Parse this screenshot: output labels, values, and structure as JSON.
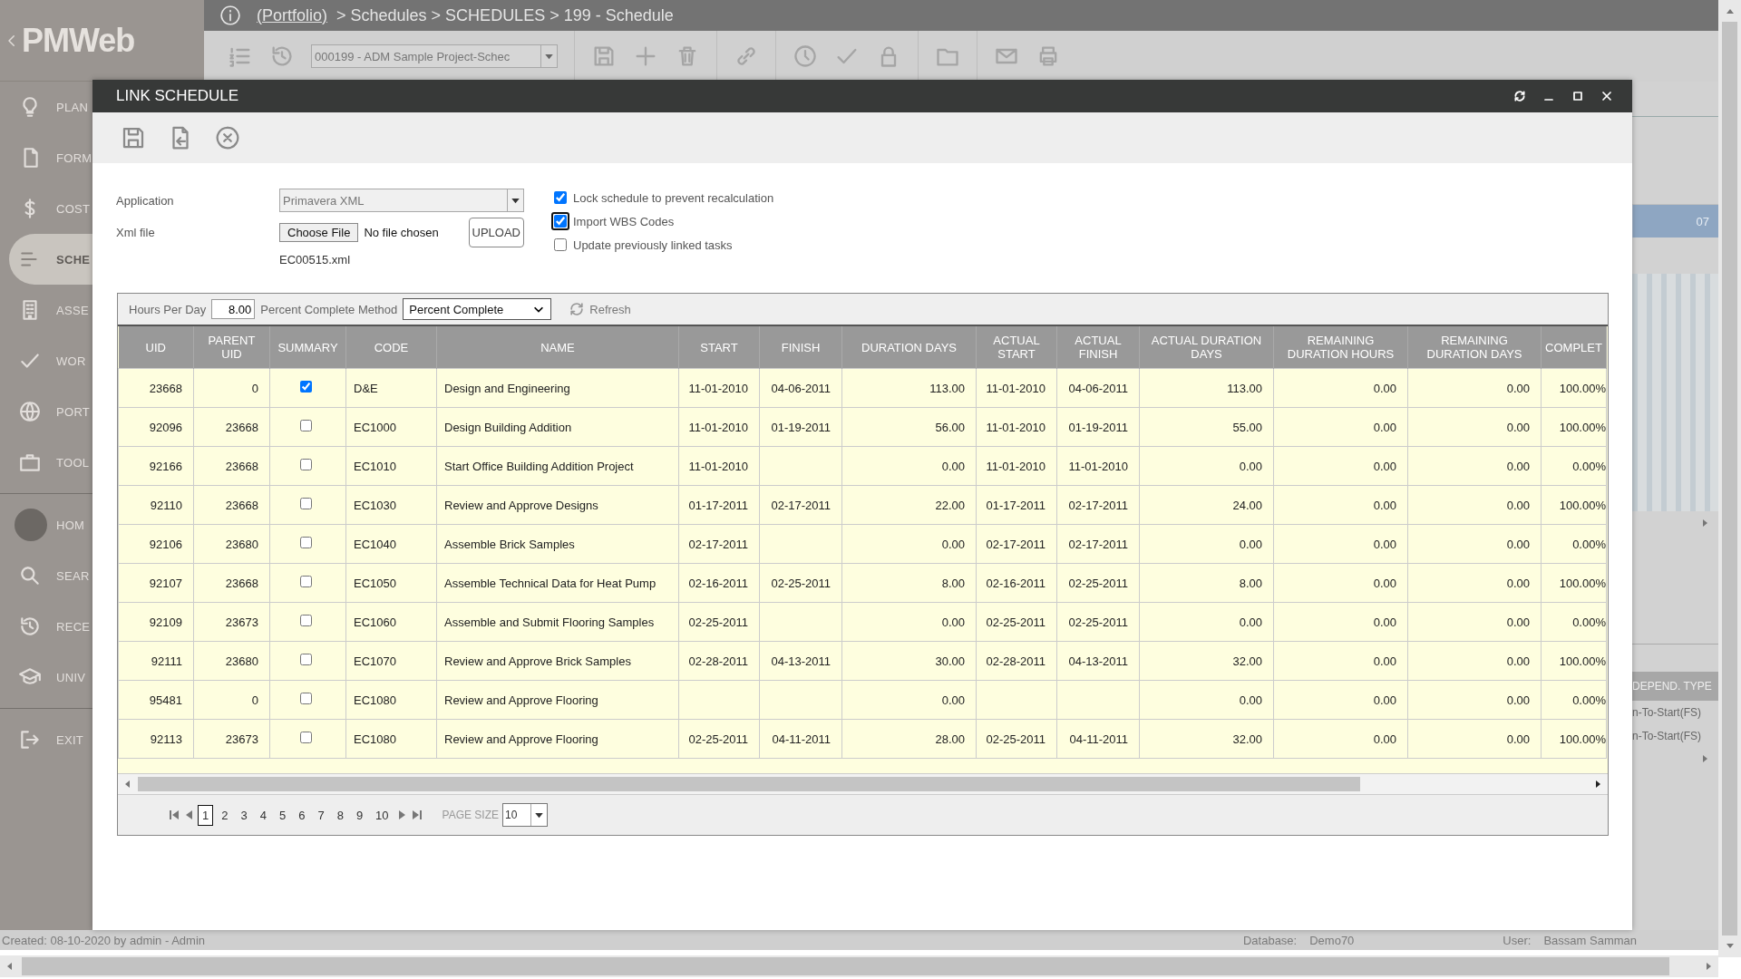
{
  "header": {
    "logo": "PMWeb",
    "breadcrumb_link": "(Portfolio)",
    "breadcrumb": "> Schedules > SCHEDULES > 199 - Schedule"
  },
  "toolbar": {
    "record": "000199 - ADM Sample Project-Schec"
  },
  "sidebar": {
    "groups": [
      {
        "items": [
          {
            "label": "PLAN",
            "selected": false
          },
          {
            "label": "FORM",
            "selected": false
          },
          {
            "label": "COST",
            "selected": false
          },
          {
            "label": "SCHE",
            "selected": true
          },
          {
            "label": "ASSE",
            "selected": false
          },
          {
            "label": "WOR",
            "selected": false
          },
          {
            "label": "PORT",
            "selected": false
          },
          {
            "label": "TOOL",
            "selected": false
          }
        ]
      },
      {
        "items": [
          {
            "label": "HOM",
            "selected": false
          },
          {
            "label": "SEAR",
            "selected": false
          },
          {
            "label": "RECE",
            "selected": false
          },
          {
            "label": "UNIV",
            "selected": false
          }
        ]
      },
      {
        "items": [
          {
            "label": "EXIT",
            "selected": false
          }
        ]
      }
    ]
  },
  "background": {
    "gantt_label": "07",
    "column_header": "DEPEND. TYPE",
    "cells": [
      "n-To-Start(FS)",
      "n-To-Start(FS)"
    ]
  },
  "dialog": {
    "title": "LINK SCHEDULE",
    "form": {
      "application_label": "Application",
      "application": "Primavera XML",
      "xml_label": "Xml file",
      "choose_button": "Choose File",
      "file_status": "No file chosen",
      "upload_button": "UPLOAD",
      "file_name": "EC00515.xml",
      "options": [
        {
          "label": "Lock schedule to prevent recalculation",
          "checked": true,
          "focused": false
        },
        {
          "label": "Import WBS Codes",
          "checked": true,
          "focused": true
        },
        {
          "label": "Update previously linked tasks",
          "checked": false,
          "focused": false
        }
      ]
    },
    "grid": {
      "hours_label": "Hours Per Day",
      "hours": "8.00",
      "method_label": "Percent Complete Method",
      "method": "Percent Complete",
      "refresh": "Refresh",
      "columns": [
        "UID",
        "PARENT UID",
        "SUMMARY",
        "CODE",
        "NAME",
        "START",
        "FINISH",
        "DURATION DAYS",
        "ACTUAL START",
        "ACTUAL FINISH",
        "ACTUAL DURATION DAYS",
        "REMAINING DURATION HOURS",
        "REMAINING DURATION DAYS",
        "COMPLET"
      ],
      "rows": [
        {
          "uid": "23668",
          "parent_uid": "0",
          "summary": true,
          "code": "D&E",
          "name": "Design and Engineering",
          "start": "11-01-2010",
          "finish": "04-06-2011",
          "duration_days": "113.00",
          "actual_start": "11-01-2010",
          "actual_finish": "04-06-2011",
          "actual_duration_days": "113.00",
          "remaining_duration_hours": "0.00",
          "remaining_duration_days": "0.00",
          "complete": "100.00%"
        },
        {
          "uid": "92096",
          "parent_uid": "23668",
          "summary": false,
          "code": "EC1000",
          "name": "Design Building Addition",
          "start": "11-01-2010",
          "finish": "01-19-2011",
          "duration_days": "56.00",
          "actual_start": "11-01-2010",
          "actual_finish": "01-19-2011",
          "actual_duration_days": "55.00",
          "remaining_duration_hours": "0.00",
          "remaining_duration_days": "0.00",
          "complete": "100.00%"
        },
        {
          "uid": "92166",
          "parent_uid": "23668",
          "summary": false,
          "code": "EC1010",
          "name": "Start Office Building Addition Project",
          "start": "11-01-2010",
          "duration_days": "0.00",
          "actual_start": "11-01-2010",
          "actual_finish": "11-01-2010",
          "actual_duration_days": "0.00",
          "remaining_duration_hours": "0.00",
          "remaining_duration_days": "0.00",
          "complete": "0.00%"
        },
        {
          "uid": "92110",
          "parent_uid": "23668",
          "summary": false,
          "code": "EC1030",
          "name": "Review and Approve Designs",
          "start": "01-17-2011",
          "finish": "02-17-2011",
          "duration_days": "22.00",
          "actual_start": "01-17-2011",
          "actual_finish": "02-17-2011",
          "actual_duration_days": "24.00",
          "remaining_duration_hours": "0.00",
          "remaining_duration_days": "0.00",
          "complete": "100.00%"
        },
        {
          "uid": "92106",
          "parent_uid": "23680",
          "summary": false,
          "code": "EC1040",
          "name": "Assemble Brick Samples",
          "start": "02-17-2011",
          "duration_days": "0.00",
          "actual_start": "02-17-2011",
          "actual_finish": "02-17-2011",
          "actual_duration_days": "0.00",
          "remaining_duration_hours": "0.00",
          "remaining_duration_days": "0.00",
          "complete": "0.00%"
        },
        {
          "uid": "92107",
          "parent_uid": "23668",
          "summary": false,
          "code": "EC1050",
          "name": "Assemble Technical Data for Heat Pump",
          "start": "02-16-2011",
          "finish": "02-25-2011",
          "duration_days": "8.00",
          "actual_start": "02-16-2011",
          "actual_finish": "02-25-2011",
          "actual_duration_days": "8.00",
          "remaining_duration_hours": "0.00",
          "remaining_duration_days": "0.00",
          "complete": "100.00%"
        },
        {
          "uid": "92109",
          "parent_uid": "23673",
          "summary": false,
          "code": "EC1060",
          "name": "Assemble and Submit Flooring Samples",
          "start": "02-25-2011",
          "duration_days": "0.00",
          "actual_start": "02-25-2011",
          "actual_finish": "02-25-2011",
          "actual_duration_days": "0.00",
          "remaining_duration_hours": "0.00",
          "remaining_duration_days": "0.00",
          "complete": "0.00%"
        },
        {
          "uid": "92111",
          "parent_uid": "23680",
          "summary": false,
          "code": "EC1070",
          "name": "Review and Approve Brick Samples",
          "start": "02-28-2011",
          "finish": "04-13-2011",
          "duration_days": "30.00",
          "actual_start": "02-28-2011",
          "actual_finish": "04-13-2011",
          "actual_duration_days": "32.00",
          "remaining_duration_hours": "0.00",
          "remaining_duration_days": "0.00",
          "complete": "100.00%"
        },
        {
          "uid": "95481",
          "parent_uid": "0",
          "summary": false,
          "code": "EC1080",
          "name": "Review and Approve Flooring",
          "duration_days": "0.00",
          "actual_duration_days": "0.00",
          "remaining_duration_hours": "0.00",
          "remaining_duration_days": "0.00",
          "complete": "0.00%"
        },
        {
          "uid": "92113",
          "parent_uid": "23673",
          "summary": false,
          "code": "EC1080",
          "name": "Review and Approve Flooring",
          "start": "02-25-2011",
          "finish": "04-11-2011",
          "duration_days": "28.00",
          "actual_start": "02-25-2011",
          "actual_finish": "04-11-2011",
          "actual_duration_days": "32.00",
          "remaining_duration_hours": "0.00",
          "remaining_duration_days": "0.00",
          "complete": "100.00%"
        }
      ],
      "pages": [
        {
          "label": "1",
          "selected": true
        },
        {
          "label": "2",
          "selected": false
        },
        {
          "label": "3",
          "selected": false
        },
        {
          "label": "4",
          "selected": false
        },
        {
          "label": "5",
          "selected": false
        },
        {
          "label": "6",
          "selected": false
        },
        {
          "label": "7",
          "selected": false
        },
        {
          "label": "8",
          "selected": false
        },
        {
          "label": "9",
          "selected": false
        },
        {
          "label": "10",
          "selected": false
        }
      ],
      "page_size_label": "PAGE SIZE",
      "page_size": "10"
    }
  },
  "status_bar": {
    "created": "Created:  08-10-2020 by admin - Admin",
    "database_label": "Database:",
    "database": "Demo70",
    "user_label": "User:",
    "user": "Bassam Samman"
  }
}
